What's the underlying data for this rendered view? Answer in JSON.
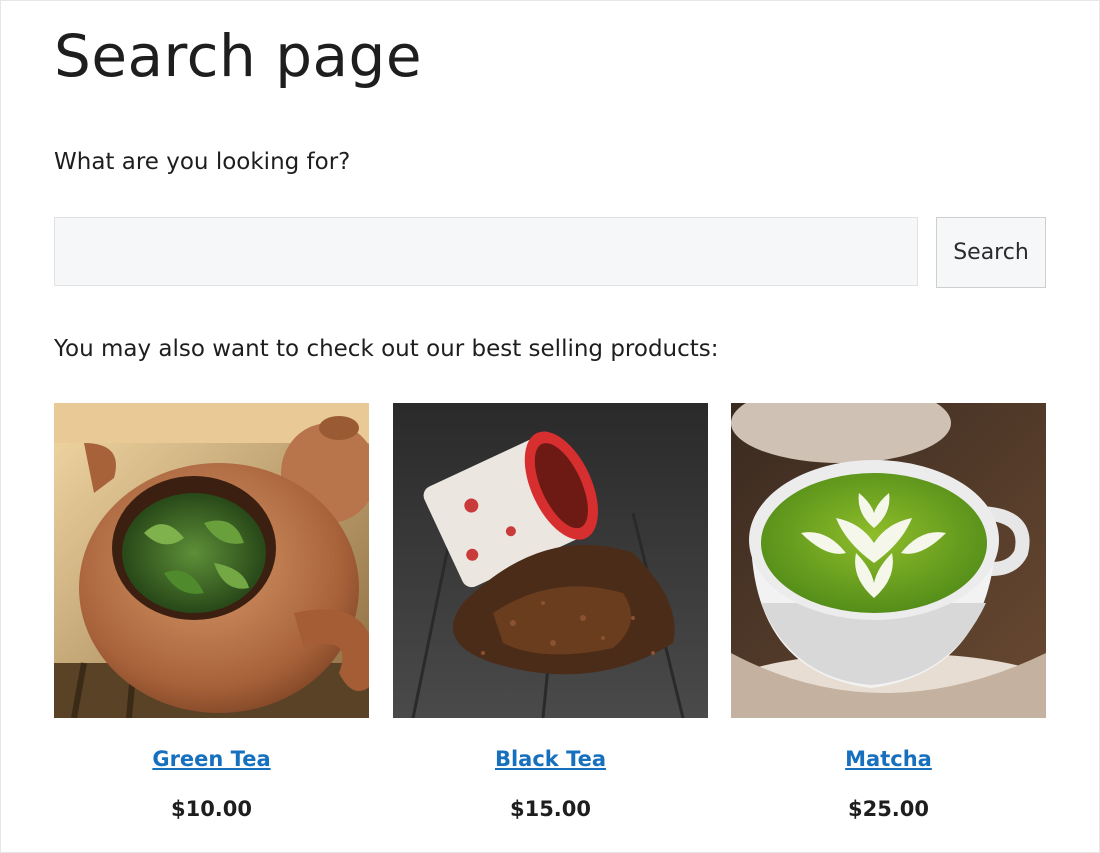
{
  "page": {
    "title": "Search page",
    "prompt": "What are you looking for?"
  },
  "search": {
    "value": "",
    "placeholder": "",
    "button_label": "Search"
  },
  "recommendations": {
    "intro": "You may also want to check out our best selling products:",
    "products": [
      {
        "name": "Green Tea",
        "price": "$10.00",
        "image": "green-tea-teapot-photo"
      },
      {
        "name": "Black Tea",
        "price": "$15.00",
        "image": "black-tea-spilled-cup-photo"
      },
      {
        "name": "Matcha",
        "price": "$25.00",
        "image": "matcha-latte-cup-photo"
      }
    ]
  },
  "colors": {
    "link": "#1770bd",
    "text": "#1e1e1e",
    "input_background": "#f6f7f8"
  }
}
